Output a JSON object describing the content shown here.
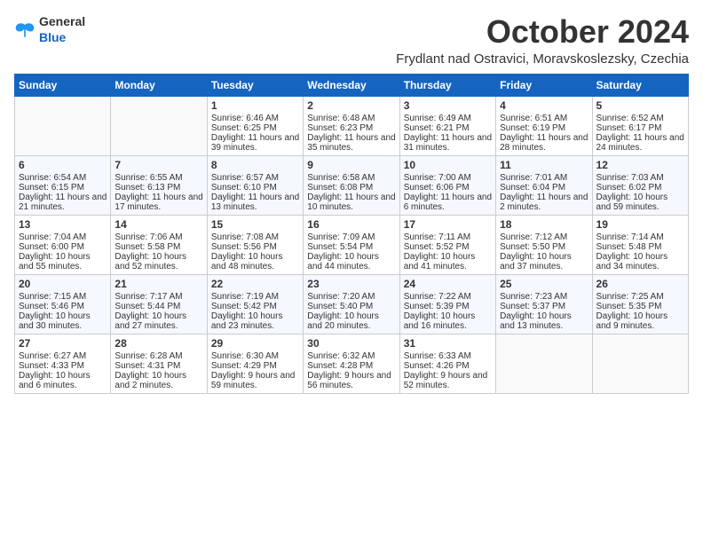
{
  "header": {
    "logo": {
      "general": "General",
      "blue": "Blue"
    },
    "title": "October 2024",
    "location": "Frydlant nad Ostravici, Moravskoslezsky, Czechia"
  },
  "weekdays": [
    "Sunday",
    "Monday",
    "Tuesday",
    "Wednesday",
    "Thursday",
    "Friday",
    "Saturday"
  ],
  "weeks": [
    [
      {
        "day": "",
        "sunrise": "",
        "sunset": "",
        "daylight": ""
      },
      {
        "day": "",
        "sunrise": "",
        "sunset": "",
        "daylight": ""
      },
      {
        "day": "1",
        "sunrise": "Sunrise: 6:46 AM",
        "sunset": "Sunset: 6:25 PM",
        "daylight": "Daylight: 11 hours and 39 minutes."
      },
      {
        "day": "2",
        "sunrise": "Sunrise: 6:48 AM",
        "sunset": "Sunset: 6:23 PM",
        "daylight": "Daylight: 11 hours and 35 minutes."
      },
      {
        "day": "3",
        "sunrise": "Sunrise: 6:49 AM",
        "sunset": "Sunset: 6:21 PM",
        "daylight": "Daylight: 11 hours and 31 minutes."
      },
      {
        "day": "4",
        "sunrise": "Sunrise: 6:51 AM",
        "sunset": "Sunset: 6:19 PM",
        "daylight": "Daylight: 11 hours and 28 minutes."
      },
      {
        "day": "5",
        "sunrise": "Sunrise: 6:52 AM",
        "sunset": "Sunset: 6:17 PM",
        "daylight": "Daylight: 11 hours and 24 minutes."
      }
    ],
    [
      {
        "day": "6",
        "sunrise": "Sunrise: 6:54 AM",
        "sunset": "Sunset: 6:15 PM",
        "daylight": "Daylight: 11 hours and 21 minutes."
      },
      {
        "day": "7",
        "sunrise": "Sunrise: 6:55 AM",
        "sunset": "Sunset: 6:13 PM",
        "daylight": "Daylight: 11 hours and 17 minutes."
      },
      {
        "day": "8",
        "sunrise": "Sunrise: 6:57 AM",
        "sunset": "Sunset: 6:10 PM",
        "daylight": "Daylight: 11 hours and 13 minutes."
      },
      {
        "day": "9",
        "sunrise": "Sunrise: 6:58 AM",
        "sunset": "Sunset: 6:08 PM",
        "daylight": "Daylight: 11 hours and 10 minutes."
      },
      {
        "day": "10",
        "sunrise": "Sunrise: 7:00 AM",
        "sunset": "Sunset: 6:06 PM",
        "daylight": "Daylight: 11 hours and 6 minutes."
      },
      {
        "day": "11",
        "sunrise": "Sunrise: 7:01 AM",
        "sunset": "Sunset: 6:04 PM",
        "daylight": "Daylight: 11 hours and 2 minutes."
      },
      {
        "day": "12",
        "sunrise": "Sunrise: 7:03 AM",
        "sunset": "Sunset: 6:02 PM",
        "daylight": "Daylight: 10 hours and 59 minutes."
      }
    ],
    [
      {
        "day": "13",
        "sunrise": "Sunrise: 7:04 AM",
        "sunset": "Sunset: 6:00 PM",
        "daylight": "Daylight: 10 hours and 55 minutes."
      },
      {
        "day": "14",
        "sunrise": "Sunrise: 7:06 AM",
        "sunset": "Sunset: 5:58 PM",
        "daylight": "Daylight: 10 hours and 52 minutes."
      },
      {
        "day": "15",
        "sunrise": "Sunrise: 7:08 AM",
        "sunset": "Sunset: 5:56 PM",
        "daylight": "Daylight: 10 hours and 48 minutes."
      },
      {
        "day": "16",
        "sunrise": "Sunrise: 7:09 AM",
        "sunset": "Sunset: 5:54 PM",
        "daylight": "Daylight: 10 hours and 44 minutes."
      },
      {
        "day": "17",
        "sunrise": "Sunrise: 7:11 AM",
        "sunset": "Sunset: 5:52 PM",
        "daylight": "Daylight: 10 hours and 41 minutes."
      },
      {
        "day": "18",
        "sunrise": "Sunrise: 7:12 AM",
        "sunset": "Sunset: 5:50 PM",
        "daylight": "Daylight: 10 hours and 37 minutes."
      },
      {
        "day": "19",
        "sunrise": "Sunrise: 7:14 AM",
        "sunset": "Sunset: 5:48 PM",
        "daylight": "Daylight: 10 hours and 34 minutes."
      }
    ],
    [
      {
        "day": "20",
        "sunrise": "Sunrise: 7:15 AM",
        "sunset": "Sunset: 5:46 PM",
        "daylight": "Daylight: 10 hours and 30 minutes."
      },
      {
        "day": "21",
        "sunrise": "Sunrise: 7:17 AM",
        "sunset": "Sunset: 5:44 PM",
        "daylight": "Daylight: 10 hours and 27 minutes."
      },
      {
        "day": "22",
        "sunrise": "Sunrise: 7:19 AM",
        "sunset": "Sunset: 5:42 PM",
        "daylight": "Daylight: 10 hours and 23 minutes."
      },
      {
        "day": "23",
        "sunrise": "Sunrise: 7:20 AM",
        "sunset": "Sunset: 5:40 PM",
        "daylight": "Daylight: 10 hours and 20 minutes."
      },
      {
        "day": "24",
        "sunrise": "Sunrise: 7:22 AM",
        "sunset": "Sunset: 5:39 PM",
        "daylight": "Daylight: 10 hours and 16 minutes."
      },
      {
        "day": "25",
        "sunrise": "Sunrise: 7:23 AM",
        "sunset": "Sunset: 5:37 PM",
        "daylight": "Daylight: 10 hours and 13 minutes."
      },
      {
        "day": "26",
        "sunrise": "Sunrise: 7:25 AM",
        "sunset": "Sunset: 5:35 PM",
        "daylight": "Daylight: 10 hours and 9 minutes."
      }
    ],
    [
      {
        "day": "27",
        "sunrise": "Sunrise: 6:27 AM",
        "sunset": "Sunset: 4:33 PM",
        "daylight": "Daylight: 10 hours and 6 minutes."
      },
      {
        "day": "28",
        "sunrise": "Sunrise: 6:28 AM",
        "sunset": "Sunset: 4:31 PM",
        "daylight": "Daylight: 10 hours and 2 minutes."
      },
      {
        "day": "29",
        "sunrise": "Sunrise: 6:30 AM",
        "sunset": "Sunset: 4:29 PM",
        "daylight": "Daylight: 9 hours and 59 minutes."
      },
      {
        "day": "30",
        "sunrise": "Sunrise: 6:32 AM",
        "sunset": "Sunset: 4:28 PM",
        "daylight": "Daylight: 9 hours and 56 minutes."
      },
      {
        "day": "31",
        "sunrise": "Sunrise: 6:33 AM",
        "sunset": "Sunset: 4:26 PM",
        "daylight": "Daylight: 9 hours and 52 minutes."
      },
      {
        "day": "",
        "sunrise": "",
        "sunset": "",
        "daylight": ""
      },
      {
        "day": "",
        "sunrise": "",
        "sunset": "",
        "daylight": ""
      }
    ]
  ]
}
